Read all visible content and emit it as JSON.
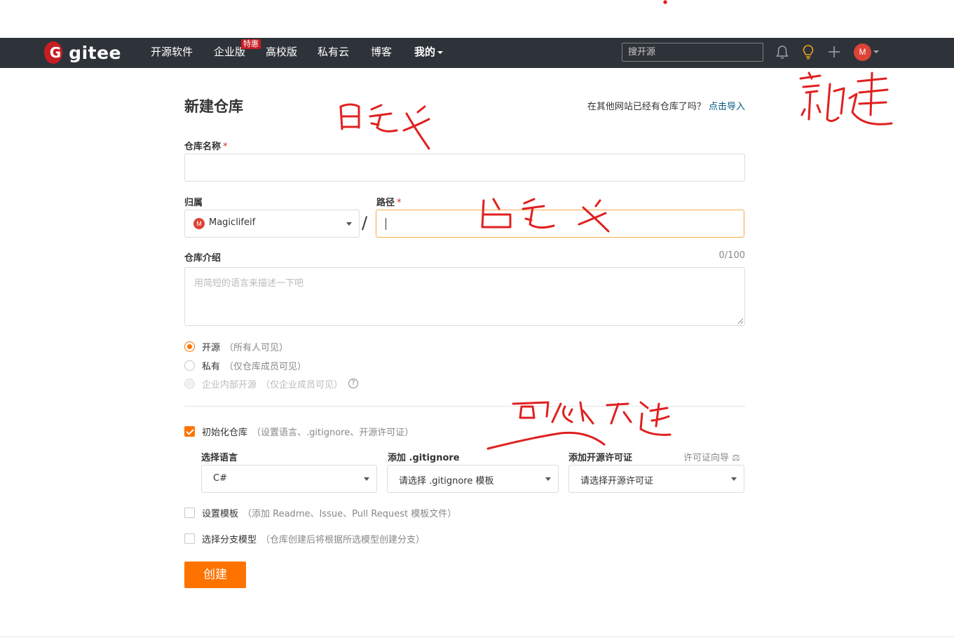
{
  "nav": {
    "logo_text": "gitee",
    "items": [
      "开源软件",
      "企业版",
      "高校版",
      "私有云",
      "博客",
      "我的"
    ],
    "badge": "特惠",
    "search_placeholder": "搜开源",
    "avatar_initial": "M",
    "icons": [
      "bell-icon",
      "lightbulb-icon",
      "plus-icon"
    ]
  },
  "form": {
    "title": "新建仓库",
    "import_hint": "在其他网站已经有仓库了吗？",
    "import_link": "点击导入",
    "repo_name_label": "仓库名称",
    "required_mark": "*",
    "owner_label": "归属",
    "owner_value": "Magiclifeif",
    "owner_avatar": "M",
    "path_separator": "/",
    "path_label": "路径",
    "desc_label": "仓库介绍",
    "desc_counter": "0/100",
    "desc_placeholder": "用简短的语言来描述一下吧",
    "visibility": [
      {
        "label": "开源",
        "note": "（所有人可见）",
        "state": "selected"
      },
      {
        "label": "私有",
        "note": "（仅仓库成员可见）",
        "state": "unselected"
      },
      {
        "label": "企业内部开源",
        "note": "（仅企业成员可见）",
        "state": "disabled"
      }
    ],
    "help_glyph": "?",
    "init_repo": {
      "label": "初始化仓库",
      "note": "（设置语言、.gitignore、开源许可证）",
      "checked": true
    },
    "language": {
      "label": "选择语言",
      "value": "C#"
    },
    "gitignore": {
      "label": "添加 .gitignore",
      "value": "请选择 .gitignore 模板"
    },
    "license": {
      "label": "添加开源许可证",
      "value": "请选择开源许可证",
      "guide": "许可证向导"
    },
    "template": {
      "label": "设置模板",
      "note": "（添加 Readme、Issue、Pull Request 模板文件）",
      "checked": false
    },
    "branch_model": {
      "label": "选择分支模型",
      "note": "（仓库创建后将根据所选模型创建分支）",
      "checked": false
    },
    "submit_label": "创建"
  },
  "colors": {
    "accent": "#fe7300",
    "navbar": "#2e333a",
    "annotation": "#e02020"
  }
}
